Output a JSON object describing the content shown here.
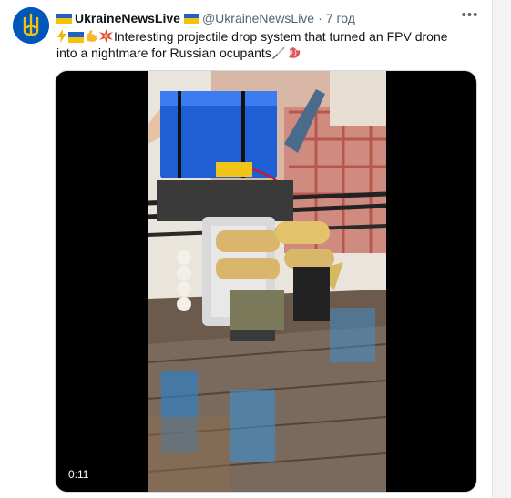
{
  "tweet": {
    "display_name": "UkraineNewsLive",
    "handle": "@UkraineNewsLive",
    "separator": "·",
    "time": "7 год",
    "text_line1": "Interesting projectile drop system that turned an FPV drone",
    "text_line2": "into a nightmare for Russian ocupants",
    "more_label": "•••"
  },
  "media": {
    "duration": "0:11"
  },
  "icons": {
    "avatar": "ukraine-trident-avatar",
    "flag": "ukraine-flag-icon",
    "more": "more-options-icon"
  },
  "colors": {
    "flag_blue": "#1d62c5",
    "flag_yellow": "#f4c20d",
    "muted_text": "#536471",
    "media_bg": "#000000"
  }
}
